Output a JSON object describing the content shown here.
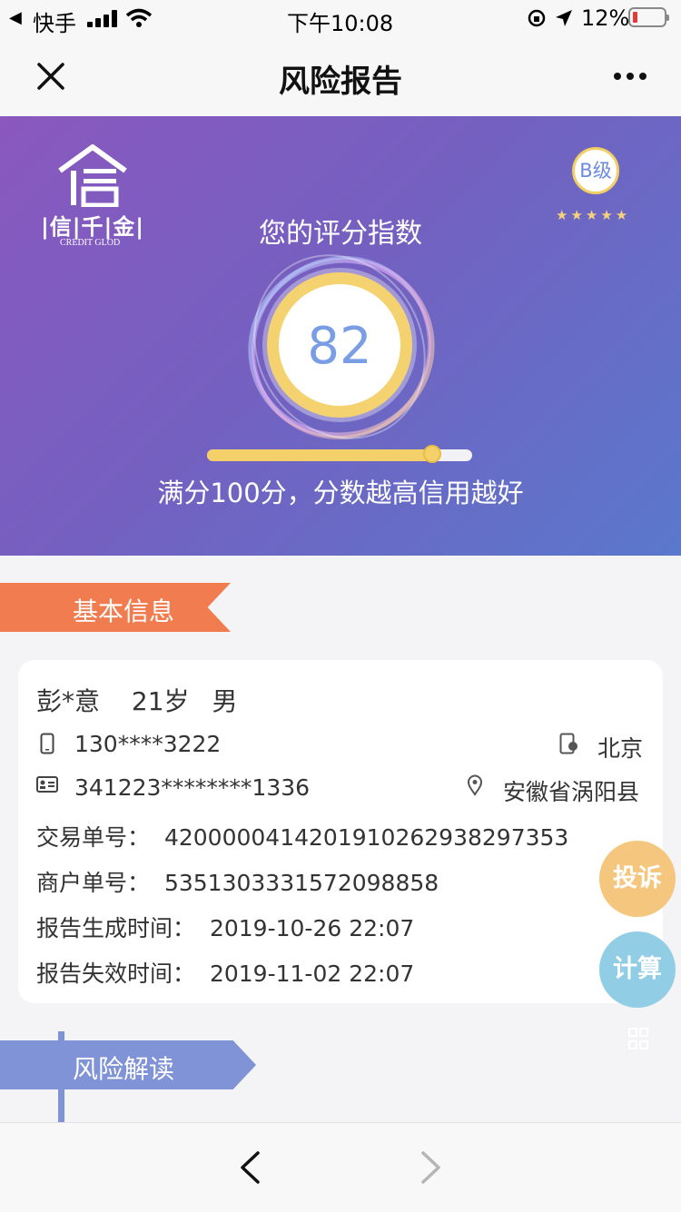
{
  "status_bar": {
    "back_app": "快手",
    "time": "下午10:08",
    "battery": "12%"
  },
  "nav": {
    "title": "风险报告",
    "close_icon": "close-icon",
    "more_icon": "more-icon"
  },
  "hero": {
    "logo_main": "|信|千|金|",
    "logo_sub": "CREDIT GLOD",
    "subtitle": "您的评分指数",
    "grade": "B级",
    "stars": "★★★★★",
    "score": "82",
    "score_fraction": 0.85,
    "tip": "满分100分，分数越高信用越好"
  },
  "basic_info": {
    "label": "基本信息",
    "name": "彭*意",
    "age": "21岁",
    "gender": "男",
    "phone": "130****3222",
    "phone_city": "北京",
    "id_number": "341223********1336",
    "id_location": "安徽省涡阳县",
    "rows": [
      {
        "label": "交易单号：",
        "value": "42000004142019102629382973​53"
      },
      {
        "label": "商户单号：",
        "value": "5351303331572098858"
      },
      {
        "label": "报告生成时间：",
        "value": "2019-10-26 22:07"
      },
      {
        "label": "报告失效时间：",
        "value": "2019-11-02 22:07"
      }
    ]
  },
  "risk": {
    "label": "风险解读"
  },
  "float_buttons": {
    "complaint": "投诉",
    "calculate": "计算"
  },
  "colors": {
    "orange_tag": "#f07c4f",
    "blue_tag": "#7f93d6",
    "score_color": "#7a9ee6",
    "complaint_btn": "#f5c77e",
    "calculate_btn": "#91cde5"
  }
}
